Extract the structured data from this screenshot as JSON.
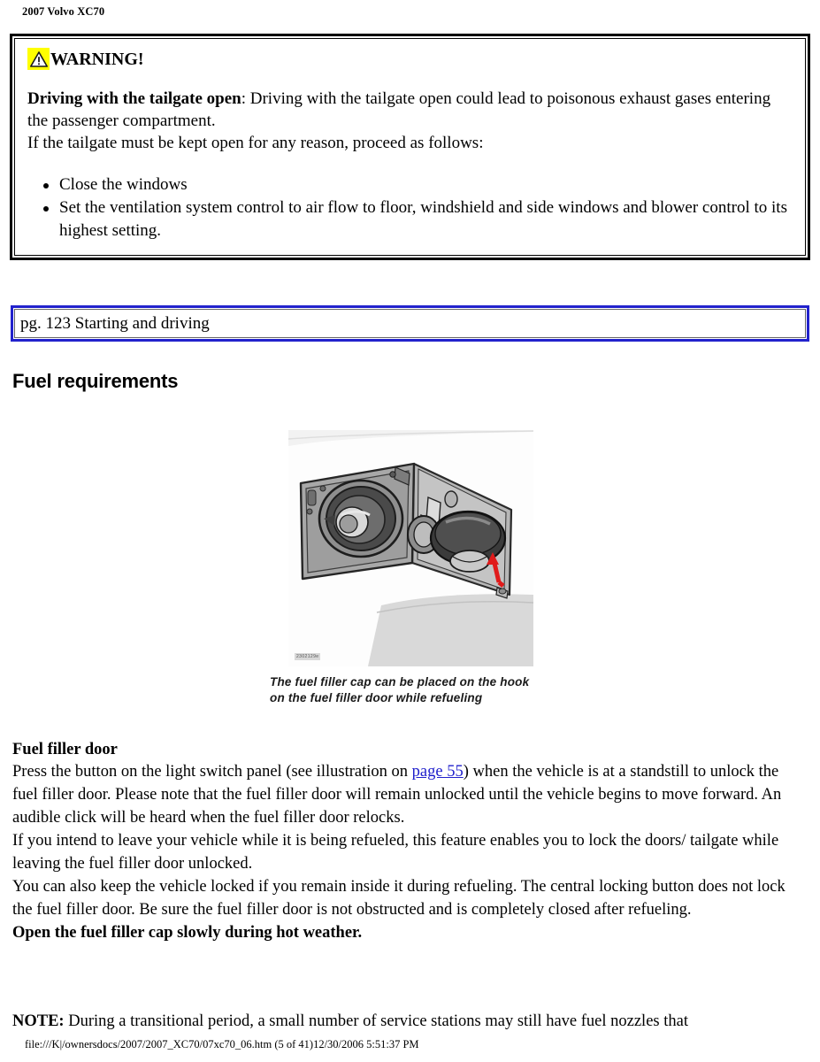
{
  "header": {
    "title": "2007 Volvo XC70"
  },
  "warning": {
    "icon": "warning-triangle-icon",
    "highlight_color": "#ffff00",
    "title": "WARNING!",
    "lead": "Driving with the tailgate open",
    "lead_rest": ": Driving with the tailgate open could lead to poisonous exhaust gases entering the passenger compartment.",
    "second_line": "If the tailgate must be kept open for any reason, proceed as follows:",
    "bullets": [
      "Close the windows",
      "Set the ventilation system control to air flow to floor, windshield and side windows and blower control to its highest setting."
    ]
  },
  "navbox": {
    "label": "pg. 123 Starting and driving",
    "border_color": "#2222cc"
  },
  "section": {
    "heading": "Fuel requirements"
  },
  "figure": {
    "id_label": "2302129e",
    "caption_line1": "The fuel filler cap can be placed on the hook",
    "caption_line2": "on the fuel filler door while refueling",
    "arrow_color": "#e01b1b"
  },
  "body": {
    "subhead": "Fuel filler door",
    "para1_before_link": "Press the button on the light switch panel (see illustration on ",
    "para1_link": "page 55",
    "para1_after_link": ") when the vehicle is at a standstill to unlock the fuel filler door. Please note that the fuel filler door will remain unlocked until the vehicle begins to move forward. An audible click will be heard when the fuel filler door relocks.",
    "para2": "If you intend to leave your vehicle while it is being refueled, this feature enables you to lock the doors/ tailgate while leaving the fuel filler door unlocked.",
    "para3": "You can also keep the vehicle locked if you remain inside it during refueling. The central locking button does not lock the fuel filler door. Be sure the fuel filler door is not obstructed and is completely closed after refueling.",
    "para4_bold": "Open the fuel filler cap slowly during hot weather.",
    "note_lead": "NOTE:",
    "note_rest": " During a transitional period, a small number of service stations may still have fuel nozzles that"
  },
  "footer": {
    "path": "file:///K|/ownersdocs/2007/2007_XC70/07xc70_06.htm (5 of 41)12/30/2006 5:51:37 PM"
  }
}
